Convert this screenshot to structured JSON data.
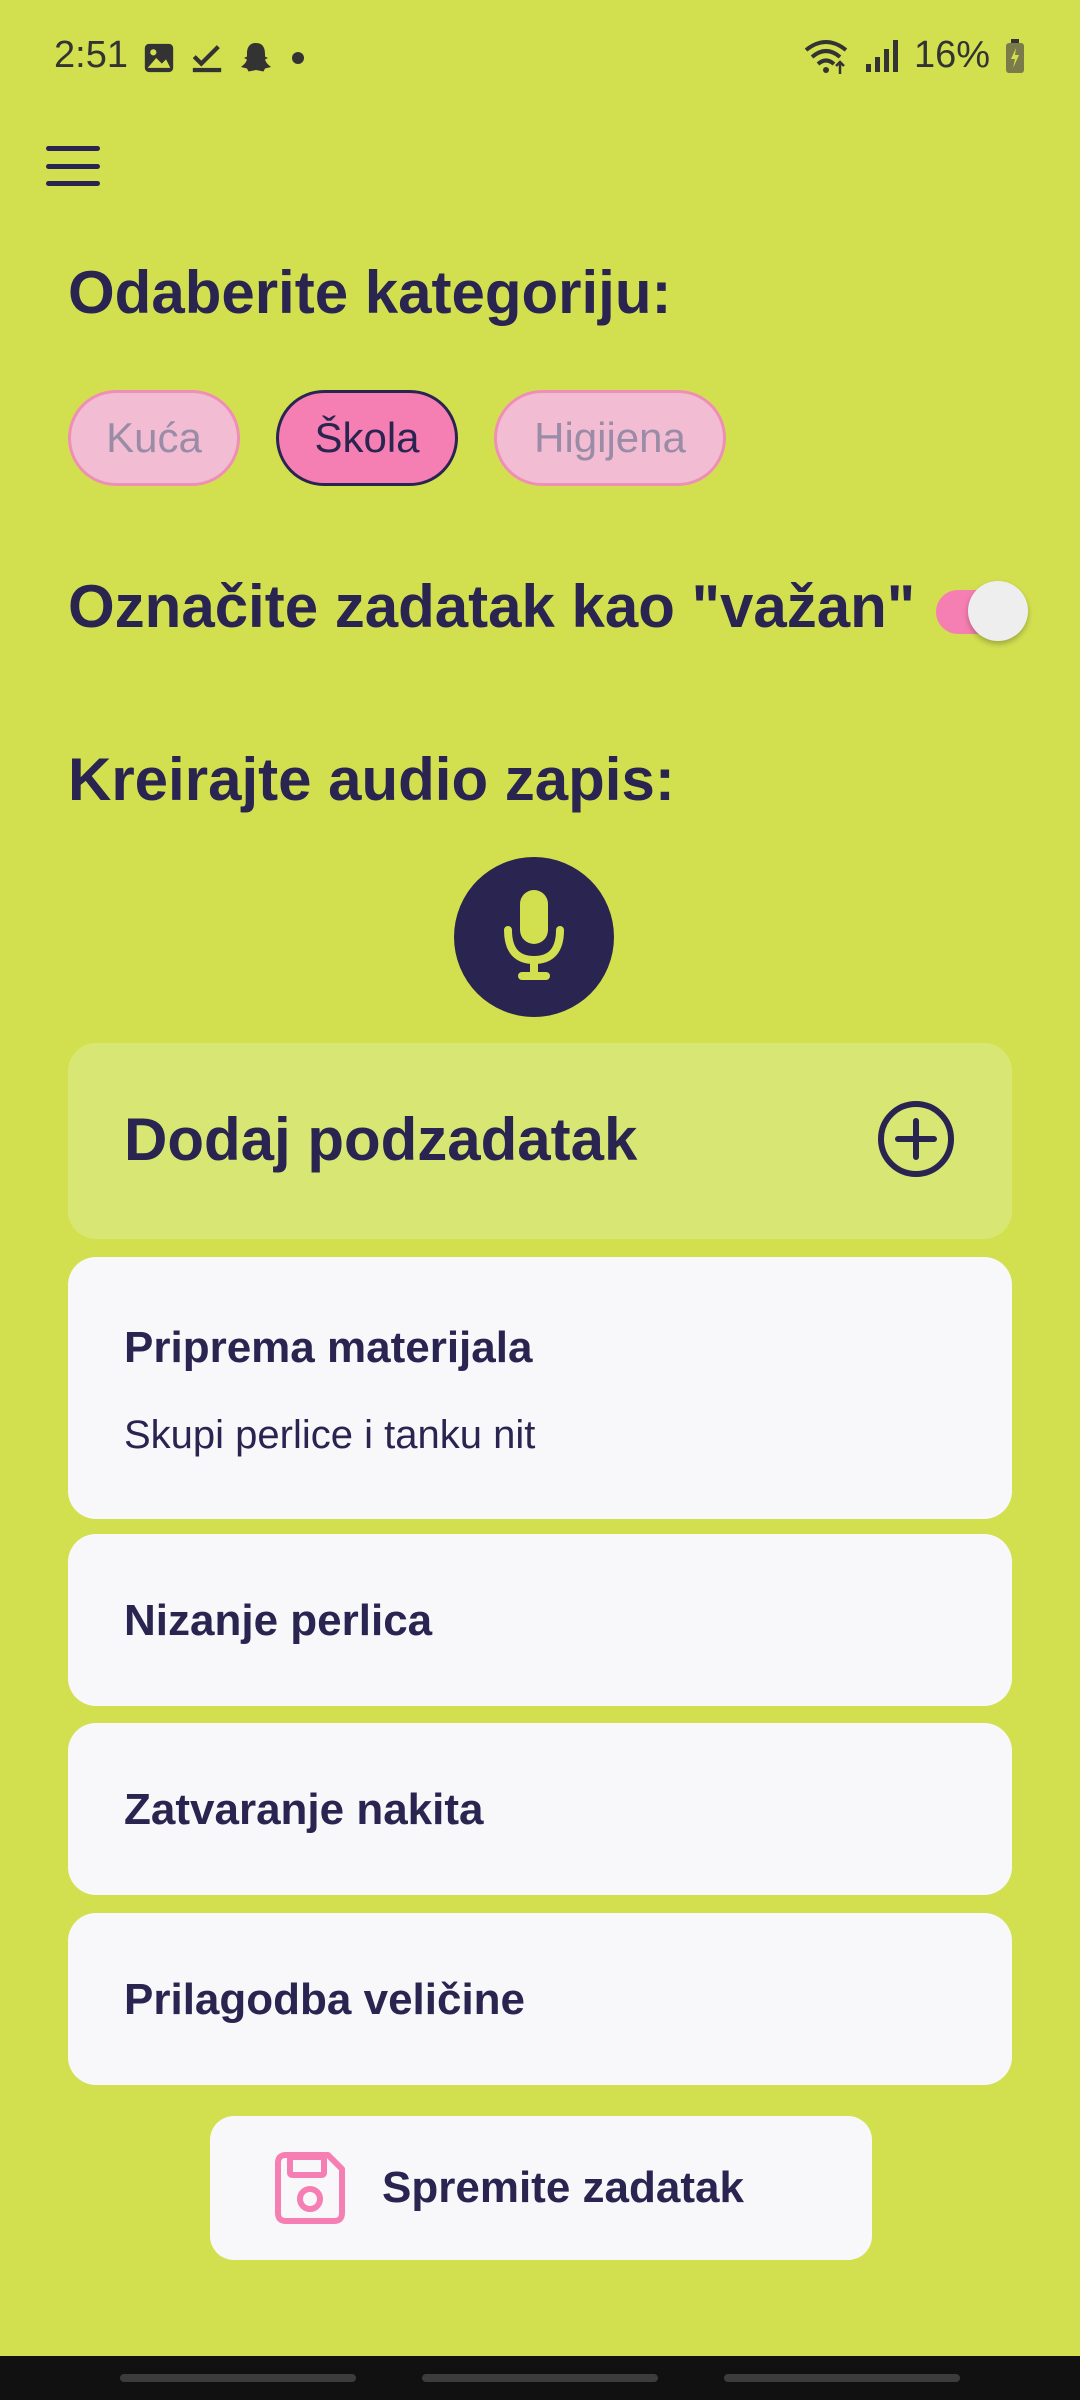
{
  "status_bar": {
    "time": "2:51",
    "battery": "16%",
    "left_icons": [
      "image-icon",
      "check-icon",
      "snapchat-icon",
      "dot-icon"
    ],
    "right_icons": [
      "wifi-icon",
      "signal-icon",
      "battery-icon"
    ]
  },
  "header": {
    "menu_icon": "hamburger-icon"
  },
  "category": {
    "heading": "Odaberite kategoriju:",
    "chips": [
      {
        "label": "Kuća",
        "selected": false
      },
      {
        "label": "Škola",
        "selected": true
      },
      {
        "label": "Higijena",
        "selected": false
      }
    ]
  },
  "important": {
    "label": "Označite zadatak kao \"važan\"",
    "enabled": true
  },
  "audio": {
    "heading": "Kreirajte audio zapis:",
    "icon": "microphone-icon"
  },
  "subtasks": {
    "add_label": "Dodaj podzadatak",
    "add_icon": "add-circle-icon",
    "items": [
      {
        "title": "Priprema materijala",
        "subtitle": "Skupi perlice i tanku nit"
      },
      {
        "title": "Nizanje perlica"
      },
      {
        "title": "Zatvaranje nakita"
      },
      {
        "title": "Prilagodba veličine"
      }
    ]
  },
  "save": {
    "label": "Spremite zadatak",
    "icon": "save-icon"
  },
  "colors": {
    "background": "#d2e050",
    "primary": "#2a2450",
    "accent_pink": "#f57fb2",
    "card": "#f8f8fb"
  }
}
